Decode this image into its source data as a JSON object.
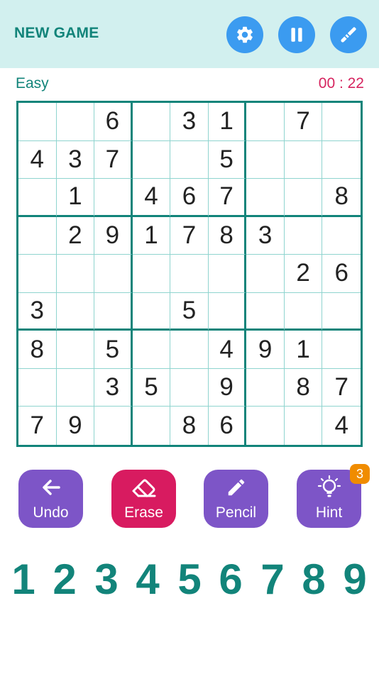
{
  "header": {
    "new_game_label": "NEW GAME",
    "settings_icon": "gear-icon",
    "pause_icon": "pause-icon",
    "theme_icon": "paint-brush-icon"
  },
  "status": {
    "difficulty": "Easy",
    "timer": "00 : 22"
  },
  "board": [
    [
      "",
      "",
      "6",
      "",
      "3",
      "1",
      "",
      "7",
      ""
    ],
    [
      "4",
      "3",
      "7",
      "",
      "",
      "5",
      "",
      "",
      ""
    ],
    [
      "",
      "1",
      "",
      "4",
      "6",
      "7",
      "",
      "",
      "8"
    ],
    [
      "",
      "2",
      "9",
      "1",
      "7",
      "8",
      "3",
      "",
      ""
    ],
    [
      "",
      "",
      "",
      "",
      "",
      "",
      "",
      "2",
      "6"
    ],
    [
      "3",
      "",
      "",
      "",
      "5",
      "",
      "",
      "",
      ""
    ],
    [
      "8",
      "",
      "5",
      "",
      "",
      "4",
      "9",
      "1",
      ""
    ],
    [
      "",
      "",
      "3",
      "5",
      "",
      "9",
      "",
      "8",
      "7"
    ],
    [
      "7",
      "9",
      "",
      "",
      "8",
      "6",
      "",
      "",
      "4"
    ]
  ],
  "tools": {
    "undo": "Undo",
    "erase": "Erase",
    "pencil": "Pencil",
    "hint": "Hint",
    "hint_count": "3"
  },
  "numpad": [
    "1",
    "2",
    "3",
    "4",
    "5",
    "6",
    "7",
    "8",
    "9"
  ],
  "colors": {
    "header_bg": "#d2f0ef",
    "accent_teal": "#12847a",
    "button_blue": "#3b9bf0",
    "tool_purple": "#7d55c7",
    "erase_pink": "#d81b60",
    "timer_red": "#d6245f",
    "badge_orange": "#f08c00"
  }
}
